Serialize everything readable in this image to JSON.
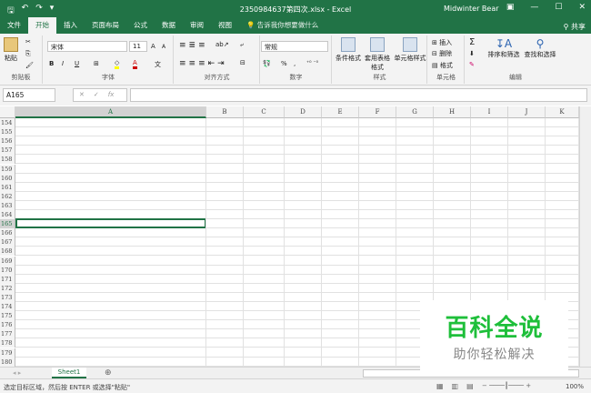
{
  "title": "2350984637第四次.xlsx - Excel",
  "user": "Midwinter Bear",
  "tabs": [
    "文件",
    "开始",
    "插入",
    "页面布局",
    "公式",
    "数据",
    "审阅",
    "视图"
  ],
  "tell_me": "告诉我你想要做什么",
  "share": "共享",
  "ribbon": {
    "clipboard": {
      "paste": "粘贴",
      "label": "剪贴板"
    },
    "font": {
      "name": "宋体",
      "size": "11",
      "bold": "B",
      "italic": "I",
      "underline": "U",
      "grow": "A",
      "shrink": "A",
      "label": "字体"
    },
    "align": {
      "label": "对齐方式"
    },
    "number": {
      "format": "常规",
      "percent": "%",
      "comma": ",",
      "label": "数字"
    },
    "styles": {
      "cond": "条件格式",
      "table": "套用表格格式",
      "cell": "单元格样式",
      "label": "样式"
    },
    "cells": {
      "insert": "插入",
      "delete": "删除",
      "format": "格式",
      "label": "单元格"
    },
    "editing": {
      "sort": "排序和筛选",
      "find": "查找和选择",
      "label": "编辑"
    }
  },
  "namebox": "A165",
  "formula_value": "",
  "columns": [
    "A",
    "B",
    "C",
    "D",
    "E",
    "F",
    "G",
    "H",
    "I",
    "J",
    "K"
  ],
  "rows": [
    154,
    155,
    156,
    157,
    158,
    159,
    160,
    161,
    162,
    163,
    164,
    165,
    166,
    167,
    168,
    169,
    170,
    171,
    172,
    173,
    174,
    175,
    176,
    177,
    178,
    179,
    180
  ],
  "selected_row": 165,
  "sheet": "Sheet1",
  "status": "选定目标区域，然后按 ENTER 或选择\"粘贴\"",
  "zoom": "100%",
  "watermark": {
    "title": "百科全说",
    "subtitle": "助你轻松解决"
  }
}
